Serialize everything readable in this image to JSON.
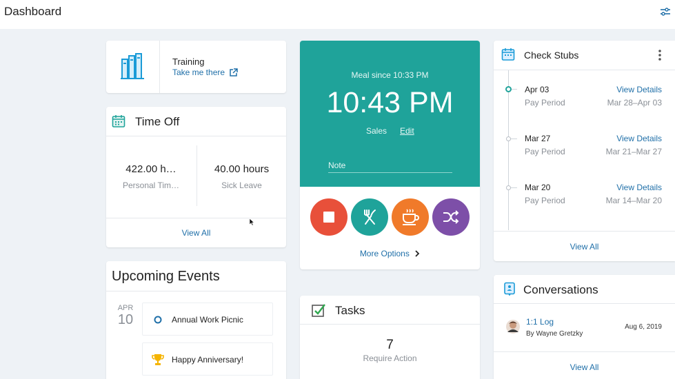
{
  "header": {
    "title": "Dashboard",
    "settings_icon": "sliders-icon"
  },
  "training": {
    "label": "Training",
    "link": "Take me there",
    "icon": "books-icon",
    "accent": "#1a9bd7"
  },
  "time_off": {
    "title": "Time Off",
    "items": [
      {
        "value": "422.00 h…",
        "label": "Personal Tim…"
      },
      {
        "value": "40.00 hours",
        "label": "Sick Leave"
      }
    ],
    "view_all": "View All"
  },
  "events": {
    "title": "Upcoming Events",
    "date_month": "APR",
    "date_day": "10",
    "items": [
      {
        "label": "Annual Work Picnic",
        "icon": "circle-icon"
      },
      {
        "label": "Happy Anniversary!",
        "icon": "trophy-icon"
      }
    ]
  },
  "clock": {
    "status": "Meal since 10:33 PM",
    "time": "10:43 PM",
    "department": "Sales",
    "edit": "Edit",
    "note_placeholder": "Note",
    "bg_color": "#1fa39a",
    "actions": [
      {
        "name": "stop",
        "color": "#e8503a"
      },
      {
        "name": "meal",
        "color": "#1fa39a"
      },
      {
        "name": "break",
        "color": "#f07a2a"
      },
      {
        "name": "transfer",
        "color": "#7d4fa8"
      }
    ],
    "more_options": "More Options"
  },
  "tasks": {
    "title": "Tasks",
    "count": "7",
    "label": "Require Action"
  },
  "check_stubs": {
    "title": "Check Stubs",
    "items": [
      {
        "date": "Apr 03",
        "type": "Pay Period",
        "link": "View Details",
        "range": "Mar 28–Apr 03"
      },
      {
        "date": "Mar 27",
        "type": "Pay Period",
        "link": "View Details",
        "range": "Mar 21–Mar 27"
      },
      {
        "date": "Mar 20",
        "type": "Pay Period",
        "link": "View Details",
        "range": "Mar 14–Mar 20"
      }
    ],
    "view_all": "View All"
  },
  "conversations": {
    "title": "Conversations",
    "items": [
      {
        "title": "1:1 Log",
        "by": "By Wayne Gretzky",
        "date": "Aug 6, 2019"
      }
    ],
    "view_all": "View All"
  }
}
